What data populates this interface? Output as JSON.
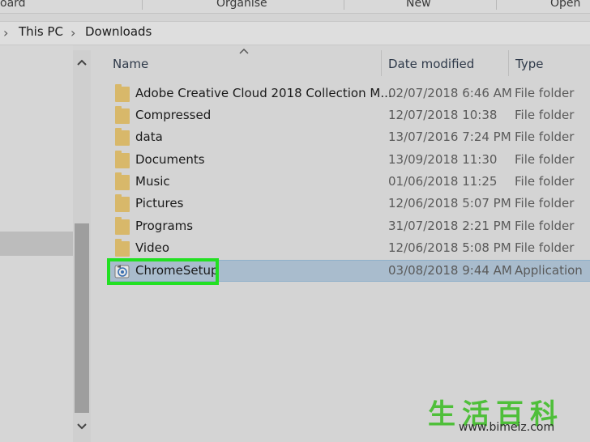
{
  "ribbon": {
    "groups": [
      "oard",
      "Organise",
      "New",
      "Open"
    ]
  },
  "address": {
    "crumbs": [
      "This PC",
      "Downloads"
    ]
  },
  "columns": {
    "name": "Name",
    "date": "Date modified",
    "type": "Type"
  },
  "files": [
    {
      "name": "Adobe Creative Cloud 2018 Collection M...",
      "date": "02/07/2018 6:46 AM",
      "type": "File folder",
      "icon": "folder-icon"
    },
    {
      "name": "Compressed",
      "date": "12/07/2018 10:38",
      "type": "File folder",
      "icon": "folder-icon"
    },
    {
      "name": "data",
      "date": "13/07/2016 7:24 PM",
      "type": "File folder",
      "icon": "folder-icon"
    },
    {
      "name": "Documents",
      "date": "13/09/2018 11:30",
      "type": "File folder",
      "icon": "folder-icon"
    },
    {
      "name": "Music",
      "date": "01/06/2018 11:25",
      "type": "File folder",
      "icon": "folder-icon"
    },
    {
      "name": "Pictures",
      "date": "12/06/2018 5:07 PM",
      "type": "File folder",
      "icon": "folder-icon"
    },
    {
      "name": "Programs",
      "date": "31/07/2018 2:21 PM",
      "type": "File folder",
      "icon": "folder-icon"
    },
    {
      "name": "Video",
      "date": "12/06/2018 5:08 PM",
      "type": "File folder",
      "icon": "folder-icon"
    },
    {
      "name": "ChromeSetup",
      "date": "03/08/2018 9:44 AM",
      "type": "Application",
      "icon": "application-icon",
      "selected": true
    }
  ],
  "colors": {
    "highlight": "#22e022",
    "selection": "#a9bccd",
    "folder": "#d8b86a"
  },
  "watermark": {
    "chars": "生活百科",
    "url": "www.bimeiz.com"
  }
}
